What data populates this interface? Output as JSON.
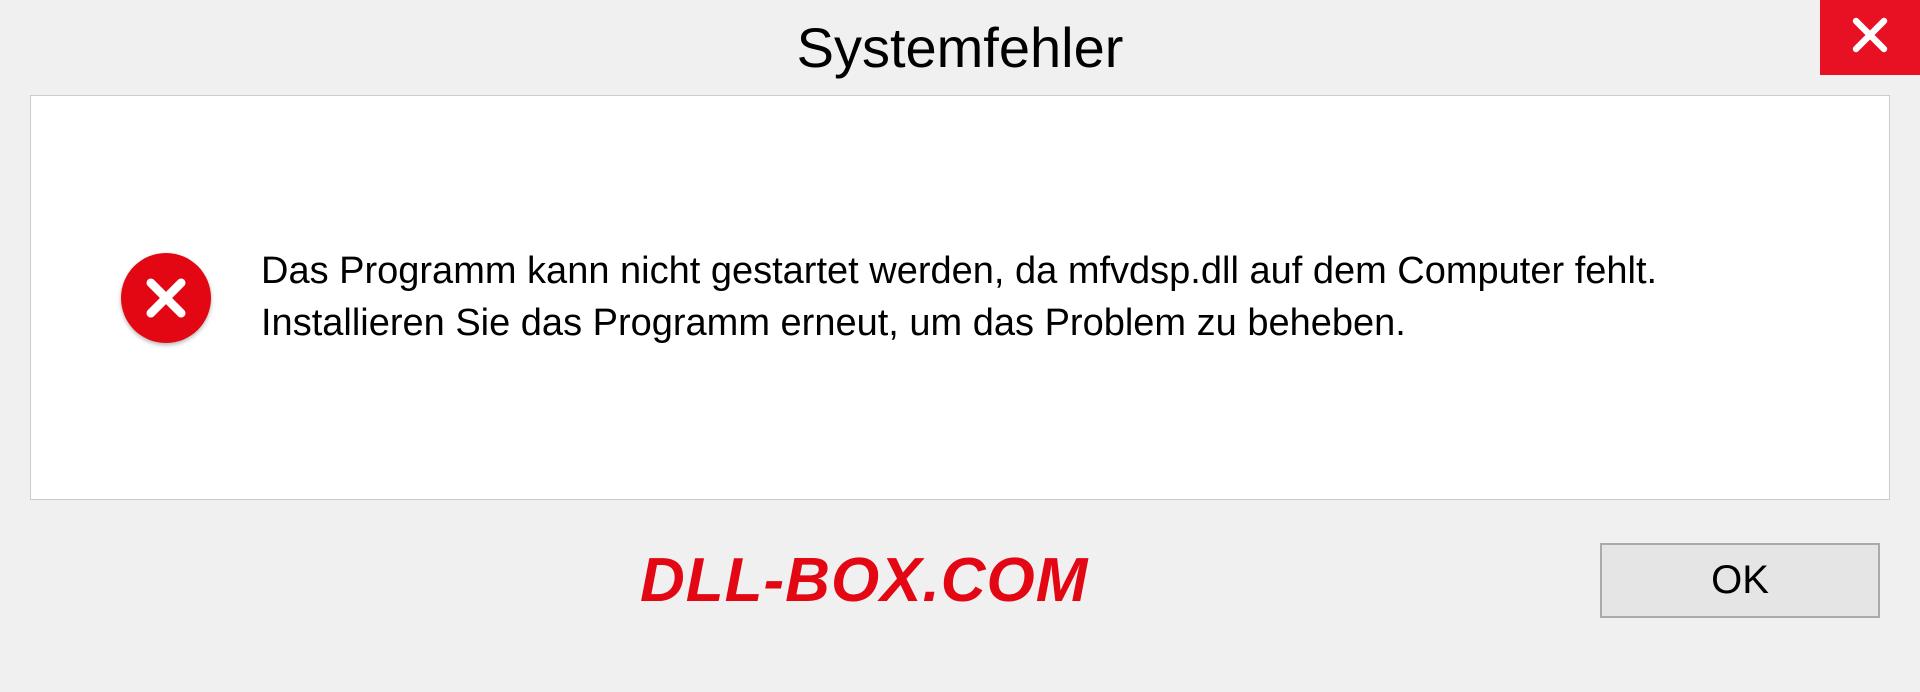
{
  "dialog": {
    "title": "Systemfehler",
    "message": "Das Programm kann nicht gestartet werden, da mfvdsp.dll auf dem Computer fehlt. Installieren Sie das Programm erneut, um das Problem zu beheben.",
    "ok_label": "OK",
    "watermark": "DLL-BOX.COM"
  }
}
